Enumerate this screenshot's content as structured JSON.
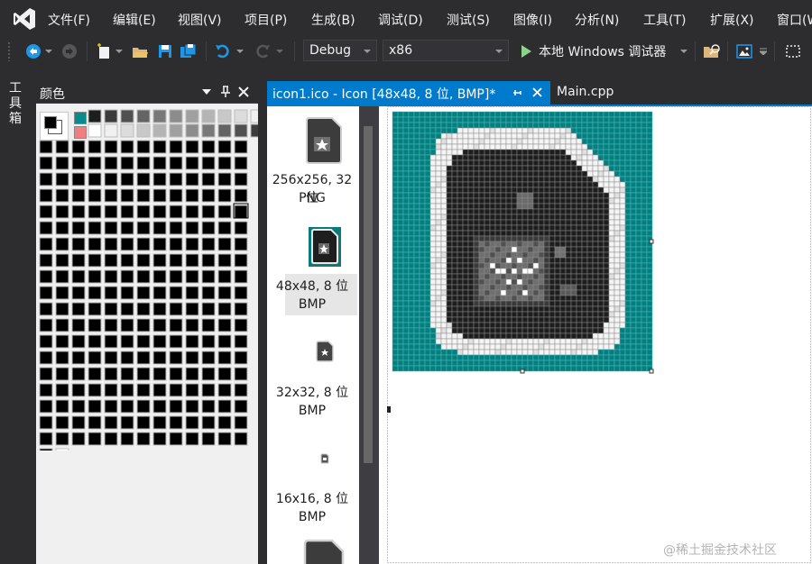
{
  "menu": {
    "items": [
      "文件(F)",
      "编辑(E)",
      "视图(V)",
      "项目(P)",
      "生成(B)",
      "调试(D)",
      "测试(S)",
      "图像(I)",
      "分析(N)",
      "工具(T)",
      "扩展(X)",
      "窗口(W)"
    ]
  },
  "toolbar": {
    "config": "Debug",
    "platform": "x86",
    "run_label": "本地 Windows 调试器"
  },
  "toolbox": {
    "label": "工具箱"
  },
  "colors_panel": {
    "title": "颜色",
    "gray_swatches": [
      "#1e1e1e",
      "#3c3c3c",
      "#505050",
      "#646464",
      "#787878",
      "#8c8c8c",
      "#a0a0a0",
      "#b4b4b4",
      "#c8c8c8",
      "#dcdcdc",
      "#f0f0f0",
      "#ffffff"
    ],
    "bottom_colors": [
      "#000000",
      "#ffffff"
    ]
  },
  "tabs": {
    "active": "icon1.ico - Icon [48x48, 8 位, BMP]*",
    "inactive": "Main.cpp"
  },
  "thumbnails": [
    {
      "line1": "256x256, 32 位",
      "line2": "PNG"
    },
    {
      "line1": "48x48, 8 位",
      "line2": "BMP"
    },
    {
      "line1": "32x32, 8 位",
      "line2": "BMP"
    },
    {
      "line1": "16x16, 8 位",
      "line2": "BMP"
    }
  ],
  "canvas": {
    "background_color": "#008080"
  },
  "watermark": "@稀土掘金技术社区"
}
